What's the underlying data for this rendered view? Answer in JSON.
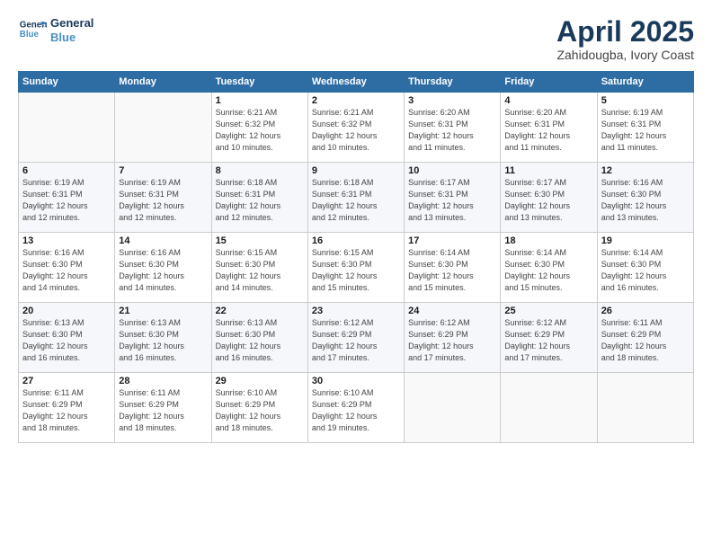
{
  "header": {
    "logo_line1": "General",
    "logo_line2": "Blue",
    "month_title": "April 2025",
    "subtitle": "Zahidougba, Ivory Coast"
  },
  "weekdays": [
    "Sunday",
    "Monday",
    "Tuesday",
    "Wednesday",
    "Thursday",
    "Friday",
    "Saturday"
  ],
  "weeks": [
    [
      {
        "day": "",
        "info": ""
      },
      {
        "day": "",
        "info": ""
      },
      {
        "day": "1",
        "info": "Sunrise: 6:21 AM\nSunset: 6:32 PM\nDaylight: 12 hours\nand 10 minutes."
      },
      {
        "day": "2",
        "info": "Sunrise: 6:21 AM\nSunset: 6:32 PM\nDaylight: 12 hours\nand 10 minutes."
      },
      {
        "day": "3",
        "info": "Sunrise: 6:20 AM\nSunset: 6:31 PM\nDaylight: 12 hours\nand 11 minutes."
      },
      {
        "day": "4",
        "info": "Sunrise: 6:20 AM\nSunset: 6:31 PM\nDaylight: 12 hours\nand 11 minutes."
      },
      {
        "day": "5",
        "info": "Sunrise: 6:19 AM\nSunset: 6:31 PM\nDaylight: 12 hours\nand 11 minutes."
      }
    ],
    [
      {
        "day": "6",
        "info": "Sunrise: 6:19 AM\nSunset: 6:31 PM\nDaylight: 12 hours\nand 12 minutes."
      },
      {
        "day": "7",
        "info": "Sunrise: 6:19 AM\nSunset: 6:31 PM\nDaylight: 12 hours\nand 12 minutes."
      },
      {
        "day": "8",
        "info": "Sunrise: 6:18 AM\nSunset: 6:31 PM\nDaylight: 12 hours\nand 12 minutes."
      },
      {
        "day": "9",
        "info": "Sunrise: 6:18 AM\nSunset: 6:31 PM\nDaylight: 12 hours\nand 12 minutes."
      },
      {
        "day": "10",
        "info": "Sunrise: 6:17 AM\nSunset: 6:31 PM\nDaylight: 12 hours\nand 13 minutes."
      },
      {
        "day": "11",
        "info": "Sunrise: 6:17 AM\nSunset: 6:30 PM\nDaylight: 12 hours\nand 13 minutes."
      },
      {
        "day": "12",
        "info": "Sunrise: 6:16 AM\nSunset: 6:30 PM\nDaylight: 12 hours\nand 13 minutes."
      }
    ],
    [
      {
        "day": "13",
        "info": "Sunrise: 6:16 AM\nSunset: 6:30 PM\nDaylight: 12 hours\nand 14 minutes."
      },
      {
        "day": "14",
        "info": "Sunrise: 6:16 AM\nSunset: 6:30 PM\nDaylight: 12 hours\nand 14 minutes."
      },
      {
        "day": "15",
        "info": "Sunrise: 6:15 AM\nSunset: 6:30 PM\nDaylight: 12 hours\nand 14 minutes."
      },
      {
        "day": "16",
        "info": "Sunrise: 6:15 AM\nSunset: 6:30 PM\nDaylight: 12 hours\nand 15 minutes."
      },
      {
        "day": "17",
        "info": "Sunrise: 6:14 AM\nSunset: 6:30 PM\nDaylight: 12 hours\nand 15 minutes."
      },
      {
        "day": "18",
        "info": "Sunrise: 6:14 AM\nSunset: 6:30 PM\nDaylight: 12 hours\nand 15 minutes."
      },
      {
        "day": "19",
        "info": "Sunrise: 6:14 AM\nSunset: 6:30 PM\nDaylight: 12 hours\nand 16 minutes."
      }
    ],
    [
      {
        "day": "20",
        "info": "Sunrise: 6:13 AM\nSunset: 6:30 PM\nDaylight: 12 hours\nand 16 minutes."
      },
      {
        "day": "21",
        "info": "Sunrise: 6:13 AM\nSunset: 6:30 PM\nDaylight: 12 hours\nand 16 minutes."
      },
      {
        "day": "22",
        "info": "Sunrise: 6:13 AM\nSunset: 6:30 PM\nDaylight: 12 hours\nand 16 minutes."
      },
      {
        "day": "23",
        "info": "Sunrise: 6:12 AM\nSunset: 6:29 PM\nDaylight: 12 hours\nand 17 minutes."
      },
      {
        "day": "24",
        "info": "Sunrise: 6:12 AM\nSunset: 6:29 PM\nDaylight: 12 hours\nand 17 minutes."
      },
      {
        "day": "25",
        "info": "Sunrise: 6:12 AM\nSunset: 6:29 PM\nDaylight: 12 hours\nand 17 minutes."
      },
      {
        "day": "26",
        "info": "Sunrise: 6:11 AM\nSunset: 6:29 PM\nDaylight: 12 hours\nand 18 minutes."
      }
    ],
    [
      {
        "day": "27",
        "info": "Sunrise: 6:11 AM\nSunset: 6:29 PM\nDaylight: 12 hours\nand 18 minutes."
      },
      {
        "day": "28",
        "info": "Sunrise: 6:11 AM\nSunset: 6:29 PM\nDaylight: 12 hours\nand 18 minutes."
      },
      {
        "day": "29",
        "info": "Sunrise: 6:10 AM\nSunset: 6:29 PM\nDaylight: 12 hours\nand 18 minutes."
      },
      {
        "day": "30",
        "info": "Sunrise: 6:10 AM\nSunset: 6:29 PM\nDaylight: 12 hours\nand 19 minutes."
      },
      {
        "day": "",
        "info": ""
      },
      {
        "day": "",
        "info": ""
      },
      {
        "day": "",
        "info": ""
      }
    ]
  ]
}
